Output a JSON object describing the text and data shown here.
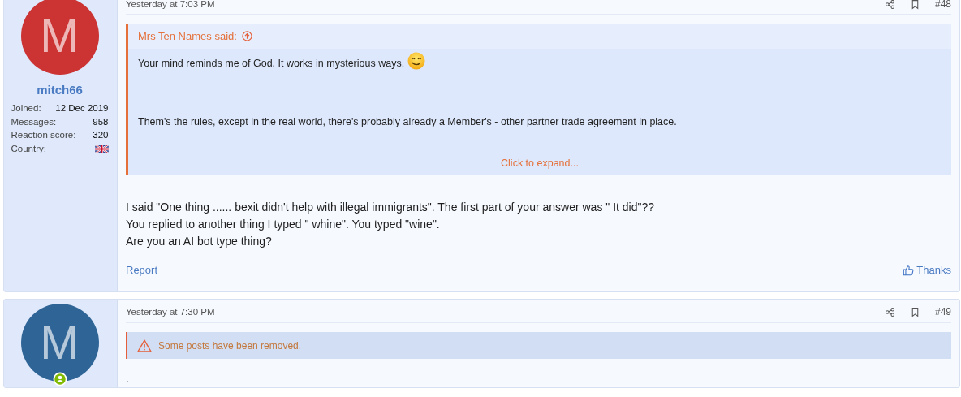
{
  "posts": [
    {
      "avatar": {
        "letter": "M",
        "color": "#cc3333",
        "online": false
      },
      "username": "mitch66",
      "stats": [
        {
          "label": "Joined:",
          "value": "12 Dec 2019",
          "kind": "text"
        },
        {
          "label": "Messages:",
          "value": "958",
          "kind": "text"
        },
        {
          "label": "Reaction score:",
          "value": "320",
          "kind": "text"
        },
        {
          "label": "Country:",
          "kind": "flag"
        }
      ],
      "timestamp": "Yesterday at 7:03 PM",
      "number": "#48",
      "quote": {
        "author": "Mrs Ten Names said:",
        "paragraphs": [
          "Your mind reminds me of God. It works in mysterious ways.",
          "Them's the rules, except in the real world, there's probably already a Member's - other partner trade agreement in place."
        ],
        "expand": "Click to expand..."
      },
      "body": [
        "I said \"One thing ...... bexit didn't help with illegal immigrants\". The first part of your answer was \" It did\"??",
        "You replied to another thing I typed \" whine\". You typed \"wine\".",
        "Are you an AI bot type thing?"
      ],
      "actions": {
        "report": "Report",
        "thanks": "Thanks"
      }
    },
    {
      "avatar": {
        "letter": "M",
        "color": "#2f6496",
        "online": true
      },
      "timestamp": "Yesterday at 7:30 PM",
      "number": "#49",
      "notice": "Some posts have been removed.",
      "body": [
        "."
      ]
    }
  ]
}
